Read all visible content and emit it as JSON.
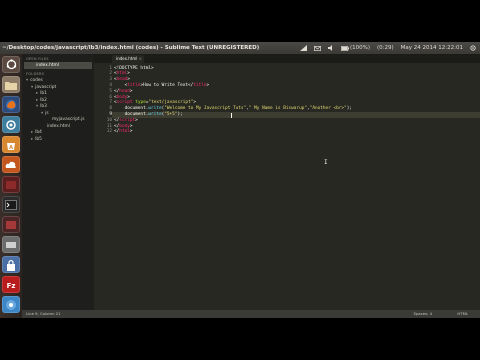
{
  "window": {
    "title": "~/Desktop/codes/javascript/lb3/index.html (codes) - Sublime Text (UNREGISTERED)"
  },
  "topbar": {
    "battery": "(100%)",
    "volume": "(0:29)",
    "datetime": "May 24 2014 12:22:01"
  },
  "launcher": {
    "items": [
      "dash-home",
      "files",
      "firefox",
      "settings",
      "appstore",
      "ubuntu-one",
      "terminal",
      "workspace",
      "system",
      "lock",
      "filezilla",
      "chromium",
      "skype",
      "vlc",
      "trash"
    ]
  },
  "sidebar": {
    "open_files_header": "OPEN FILES",
    "open_file": "index.html",
    "folders_header": "FOLDERS",
    "tree": [
      {
        "label": "codes",
        "depth": 0,
        "open": true
      },
      {
        "label": "javascript",
        "depth": 1,
        "open": true
      },
      {
        "label": "lb1",
        "depth": 2,
        "open": false
      },
      {
        "label": "lb2",
        "depth": 2,
        "open": false
      },
      {
        "label": "lb3",
        "depth": 2,
        "open": true
      },
      {
        "label": "js",
        "depth": 3,
        "open": true
      },
      {
        "label": "myjavascript.js",
        "depth": 4,
        "open": null
      },
      {
        "label": "index.html",
        "depth": 3,
        "open": null
      },
      {
        "label": "lb4",
        "depth": 1,
        "open": false
      },
      {
        "label": "lb5",
        "depth": 1,
        "open": false
      }
    ]
  },
  "tab": {
    "label": "index.html",
    "close": "×"
  },
  "editor": {
    "line_numbers": [
      "1",
      "2",
      "3",
      "4",
      "5",
      "6",
      "7",
      "8",
      "9",
      "10",
      "11",
      "12"
    ],
    "current_line": 9,
    "lines": [
      {
        "segments": [
          {
            "c": "p",
            "t": "<!DOCTYPE html>"
          }
        ]
      },
      {
        "segments": [
          {
            "c": "p",
            "t": "<"
          },
          {
            "c": "t",
            "t": "html"
          },
          {
            "c": "p",
            "t": ">"
          }
        ]
      },
      {
        "segments": [
          {
            "c": "p",
            "t": "<"
          },
          {
            "c": "t",
            "t": "head"
          },
          {
            "c": "p",
            "t": ">"
          }
        ]
      },
      {
        "segments": [
          {
            "c": "p",
            "t": "    <"
          },
          {
            "c": "t",
            "t": "title"
          },
          {
            "c": "p",
            "t": ">How to Write Text</"
          },
          {
            "c": "t",
            "t": "title"
          },
          {
            "c": "p",
            "t": ">"
          }
        ]
      },
      {
        "segments": [
          {
            "c": "p",
            "t": "</"
          },
          {
            "c": "t",
            "t": "head"
          },
          {
            "c": "p",
            "t": ">"
          }
        ]
      },
      {
        "segments": [
          {
            "c": "p",
            "t": "<"
          },
          {
            "c": "t",
            "t": "body"
          },
          {
            "c": "p",
            "t": ">"
          }
        ]
      },
      {
        "segments": [
          {
            "c": "p",
            "t": "<"
          },
          {
            "c": "t",
            "t": "script"
          },
          {
            "c": "p",
            "t": " "
          },
          {
            "c": "a",
            "t": "type"
          },
          {
            "c": "p",
            "t": "="
          },
          {
            "c": "s",
            "t": "\"text/javascript\""
          },
          {
            "c": "p",
            "t": ">"
          }
        ]
      },
      {
        "segments": [
          {
            "c": "p",
            "t": "    document."
          },
          {
            "c": "f",
            "t": "write"
          },
          {
            "c": "p",
            "t": "("
          },
          {
            "c": "s",
            "t": "\"Welcome to My Javascript Tuts\""
          },
          {
            "c": "p",
            "t": ","
          },
          {
            "c": "s",
            "t": "\" My Name is Biswarup\""
          },
          {
            "c": "p",
            "t": ","
          },
          {
            "c": "s",
            "t": "\"Another <br>\""
          },
          {
            "c": "p",
            "t": ");"
          }
        ]
      },
      {
        "segments": [
          {
            "c": "p",
            "t": "    document."
          },
          {
            "c": "f",
            "t": "write"
          },
          {
            "c": "p",
            "t": "("
          },
          {
            "c": "s",
            "t": "\"5+5\""
          },
          {
            "c": "p",
            "t": ");"
          }
        ]
      },
      {
        "segments": [
          {
            "c": "p",
            "t": "</"
          },
          {
            "c": "t",
            "t": "script"
          },
          {
            "c": "p",
            "t": ">"
          }
        ]
      },
      {
        "segments": [
          {
            "c": "p",
            "t": "</"
          },
          {
            "c": "t",
            "t": "body"
          },
          {
            "c": "p",
            "t": ">"
          }
        ]
      },
      {
        "segments": [
          {
            "c": "p",
            "t": "</"
          },
          {
            "c": "t",
            "t": "html"
          },
          {
            "c": "p",
            "t": ">"
          }
        ]
      }
    ],
    "ibeam": "I"
  },
  "status": {
    "position": "Line 9, Column 21",
    "indent": "Spaces: 4",
    "syntax": "HTML"
  },
  "colors": {
    "tag": "#f92672",
    "attribute": "#a6e22e",
    "string": "#e6db74",
    "function": "#66d9ef",
    "text": "#f8f8f2",
    "background": "#272822"
  }
}
